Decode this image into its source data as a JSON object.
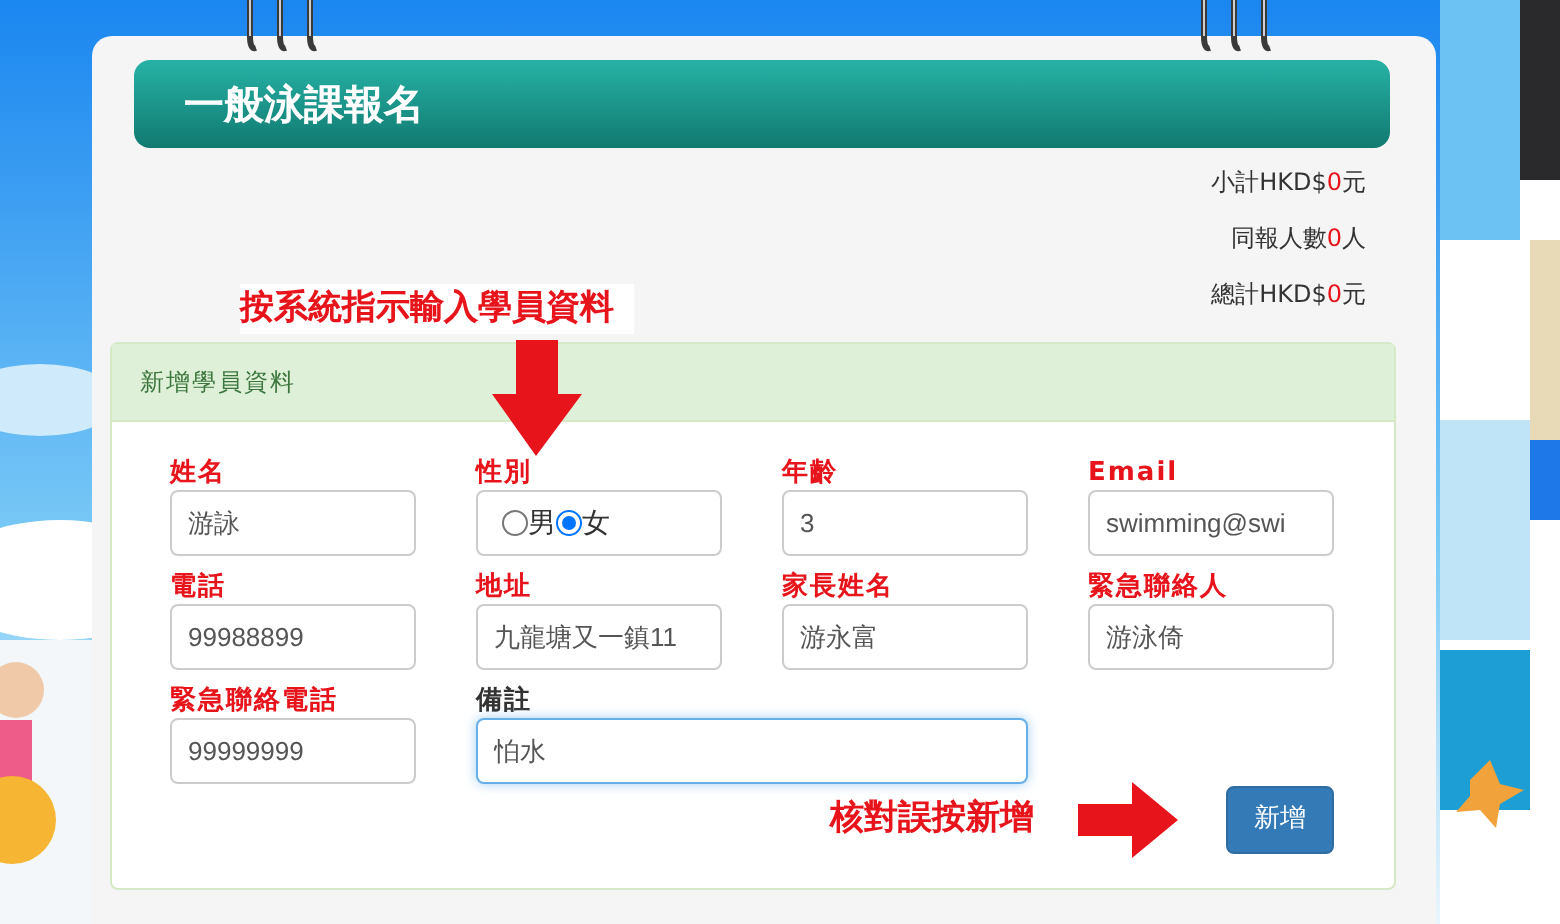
{
  "title": "一般泳課報名",
  "summary": [
    {
      "prefix": "小計HKD$",
      "value": "0",
      "suffix": "元"
    },
    {
      "prefix": "同報人數",
      "value": "0",
      "suffix": "人"
    },
    {
      "prefix": "總計HKD$",
      "value": "0",
      "suffix": "元"
    }
  ],
  "instruction": "按系統指示輸入學員資料",
  "panel": {
    "title": "新增學員資料",
    "fields": [
      {
        "label": "姓名",
        "required": true,
        "kind": "text",
        "value": "游詠"
      },
      {
        "label": "性別",
        "required": true,
        "kind": "radio",
        "options": [
          {
            "label": "男",
            "selected": false
          },
          {
            "label": "女",
            "selected": true
          }
        ]
      },
      {
        "label": "年齡",
        "required": true,
        "kind": "text",
        "value": "3"
      },
      {
        "label": "Email",
        "required": true,
        "kind": "text",
        "value": "swimming@swi"
      },
      {
        "label": "電話",
        "required": true,
        "kind": "text",
        "value": "99988899"
      },
      {
        "label": "地址",
        "required": true,
        "kind": "text",
        "value": "九龍塘又一鎮11"
      },
      {
        "label": "家長姓名",
        "required": true,
        "kind": "text",
        "value": "游永富"
      },
      {
        "label": "緊急聯絡人",
        "required": true,
        "kind": "text",
        "value": "游泳倚"
      },
      {
        "label": "緊急聯絡電話",
        "required": true,
        "kind": "text",
        "value": "99999999"
      },
      {
        "label": "備註",
        "required": false,
        "kind": "wide",
        "value": "怕水",
        "focused": true
      }
    ],
    "hint": "核對誤按新增",
    "button": "新增"
  }
}
